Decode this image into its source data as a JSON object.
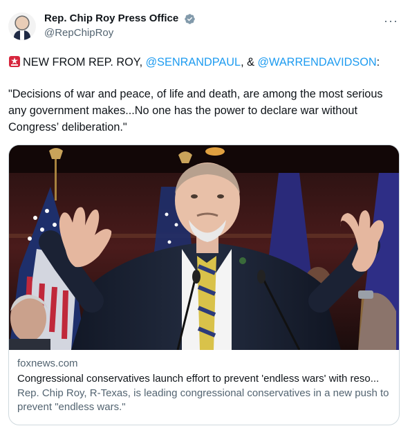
{
  "author": {
    "display_name": "Rep. Chip Roy Press Office",
    "handle": "@RepChipRoy",
    "avatar_icon": "avatar",
    "verified_icon": "verified-badge-icon"
  },
  "more_icon": "more-options-icon",
  "tweet": {
    "line_prefix": "NEW FROM REP. ROY, ",
    "mention_1": "@SENRANDPAUL",
    "separator": ", & ",
    "mention_2": "@WARRENDAVIDSON",
    "suffix": ":",
    "quote": "\"Decisions of war and peace, of life and death, are among the most serious any government makes...No one has the power to declare war without Congress’ deliberation.\""
  },
  "card": {
    "domain": "foxnews.com",
    "title": "Congressional conservatives launch effort to prevent 'endless wars' with reso...",
    "description": "Rep. Chip Roy, R-Texas, is leading congressional conservatives in a new push to prevent \"endless wars.\""
  },
  "colors": {
    "link": "#1d9bf0",
    "secondary_text": "#536471",
    "primary_text": "#0f1419",
    "border": "#cfd9de"
  }
}
